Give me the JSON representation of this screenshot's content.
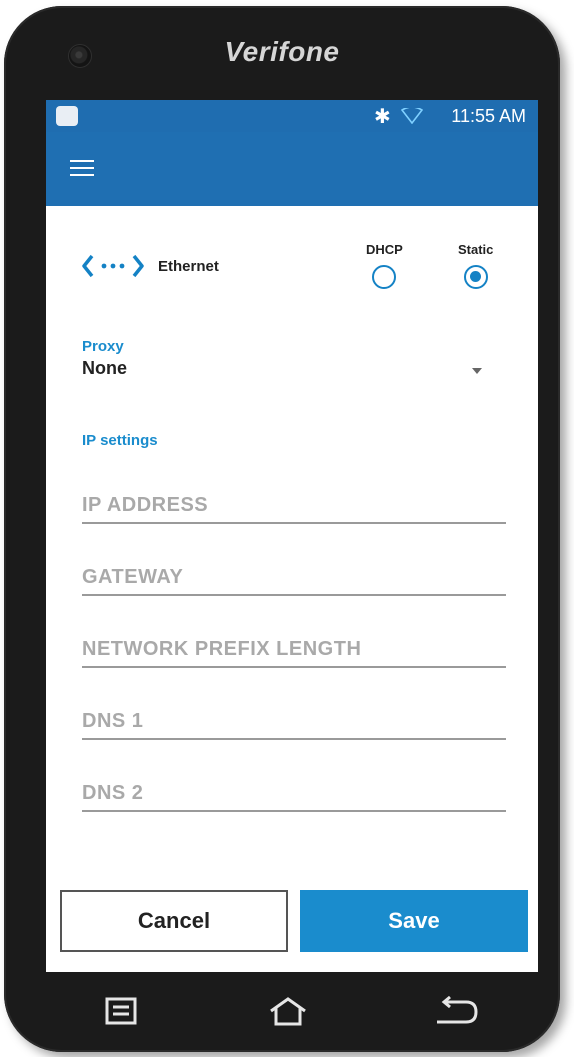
{
  "device": {
    "brand": "Verifone"
  },
  "status_bar": {
    "time": "11:55 AM",
    "icons": [
      "app-notification-icon",
      "bluetooth-icon",
      "wifi-icon"
    ]
  },
  "app_bar": {
    "menu_icon": "menu-icon"
  },
  "ethernet": {
    "icon": "ethernet-icon",
    "label": "Ethernet",
    "modes": [
      {
        "label": "DHCP",
        "selected": false
      },
      {
        "label": "Static",
        "selected": true
      }
    ]
  },
  "proxy": {
    "label": "Proxy",
    "value": "None"
  },
  "ip_settings": {
    "title": "IP settings",
    "fields": [
      {
        "placeholder": "IP ADDRESS",
        "value": ""
      },
      {
        "placeholder": "GATEWAY",
        "value": ""
      },
      {
        "placeholder": "NETWORK PREFIX LENGTH",
        "value": ""
      },
      {
        "placeholder": "DNS 1",
        "value": ""
      },
      {
        "placeholder": "DNS 2",
        "value": ""
      }
    ]
  },
  "actions": {
    "cancel_label": "Cancel",
    "save_label": "Save"
  },
  "colors": {
    "status_bar": "#1f6db0",
    "accent": "#1a8ccd",
    "device": "#1b1b1b"
  },
  "nav_keys": [
    "recents-icon",
    "home-icon",
    "back-icon"
  ]
}
